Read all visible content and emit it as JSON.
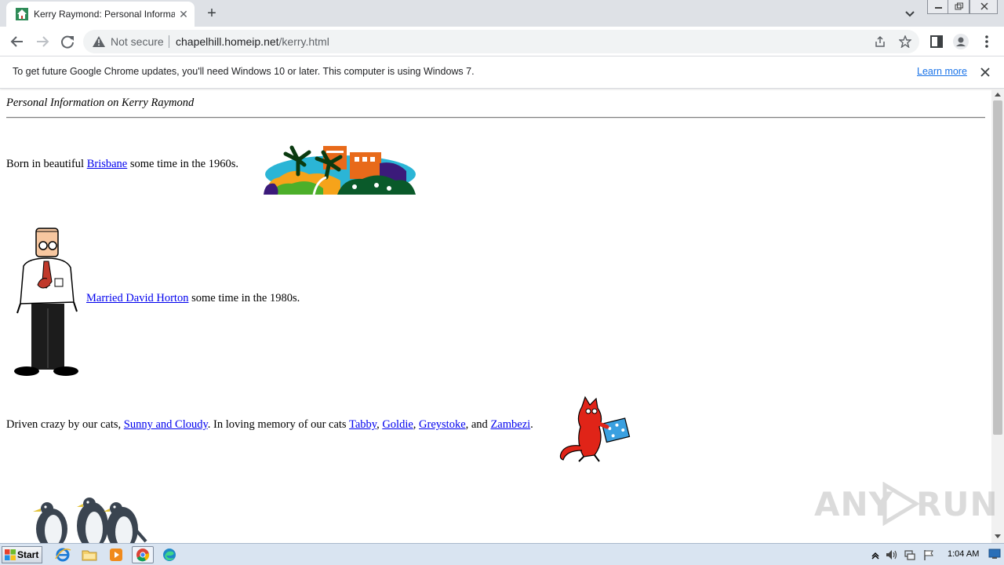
{
  "browser": {
    "tab": {
      "title": "Kerry Raymond: Personal Information on Kerry Raymond",
      "favicon": "house-favicon",
      "close_icon": "close-icon"
    },
    "new_tab_icon": "plus-icon",
    "tab_search_icon": "chevron-down-icon",
    "window_controls": [
      "minimize-icon",
      "restore-icon",
      "close-icon"
    ],
    "nav": {
      "back_icon": "back-arrow-icon",
      "forward_icon": "forward-arrow-icon",
      "reload_icon": "reload-icon"
    },
    "omnibox": {
      "security_label": "Not secure",
      "security_icon": "warning-triangle-icon",
      "url_host": "chapelhill.homeip.net",
      "url_path": "/kerry.html",
      "share_icon": "share-icon",
      "bookmark_icon": "star-icon"
    },
    "toolbar_icons": [
      "side-panel-icon",
      "profile-icon",
      "menu-kebab-icon"
    ]
  },
  "infobar": {
    "message": "To get future Google Chrome updates, you'll need Windows 10 or later. This computer is using Windows 7.",
    "link": "Learn more",
    "close_icon": "close-icon"
  },
  "page": {
    "heading": "Personal Information on Kerry Raymond",
    "born": {
      "prefix": "Born in beautiful",
      "link": "Brisbane",
      "suffix": "some time in the 1960s.",
      "image": "brisbane-skyline-clipart"
    },
    "married": {
      "image": "dilbert-cartoon-man",
      "link": "Married David Horton",
      "suffix": "some time in the 1980s."
    },
    "cats": {
      "prefix": "Driven crazy by our cats,",
      "link_current": "Sunny and Cloudy",
      "middle": ". In loving memory of our cats",
      "links_memory": [
        "Tabby",
        "Goldie",
        "Greystoke",
        "Zambezi"
      ],
      "sep_comma": ",",
      "sep_and": ", and",
      "end": ".",
      "image": "red-cat-with-sign-clipart"
    },
    "penguins_image": "penguins-clipart"
  },
  "watermark": {
    "text_left": "ANY",
    "text_right": "RUN"
  },
  "taskbar": {
    "start_label": "Start",
    "apps": [
      "internet-explorer-icon",
      "folder-icon",
      "media-player-icon",
      "chrome-icon",
      "edge-icon"
    ],
    "tray": [
      "show-hidden-icons",
      "volume-icon",
      "network-icon",
      "action-center-flag-icon"
    ],
    "clock": "1:04 AM"
  },
  "colors": {
    "link": "#0000ee",
    "chrome_accent": "#1a73e8",
    "tabstrip_bg": "#dee1e6",
    "taskbar_bg": "#d9e4f1"
  }
}
